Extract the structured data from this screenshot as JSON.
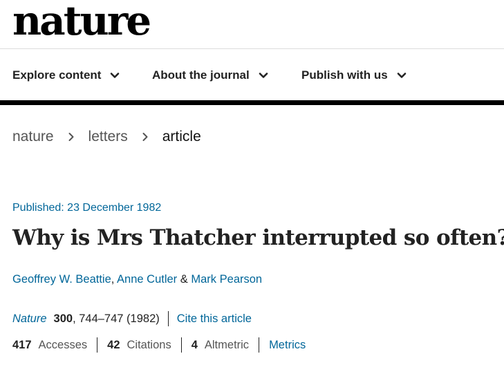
{
  "header": {
    "logo_text": "nature"
  },
  "nav": {
    "items": [
      {
        "label": "Explore content"
      },
      {
        "label": "About the journal"
      },
      {
        "label": "Publish with us"
      }
    ]
  },
  "breadcrumb": {
    "items": [
      {
        "label": "nature"
      },
      {
        "label": "letters"
      },
      {
        "label": "article"
      }
    ]
  },
  "article": {
    "published": "Published: 23 December 1982",
    "title": "Why is Mrs Thatcher interrupted so often?",
    "authors": [
      "Geoffrey W. Beattie",
      "Anne Cutler",
      "Mark Pearson"
    ],
    "author_sep": ",",
    "author_amp": "&",
    "citation": {
      "journal": "Nature",
      "volume": "300",
      "details": ", 744–747 (1982)",
      "cite_label": "Cite this article"
    },
    "metrics": {
      "accesses_count": "417",
      "accesses_label": "Accesses",
      "citations_count": "42",
      "citations_label": "Citations",
      "altmetric_count": "4",
      "altmetric_label": "Altmetric",
      "metrics_link": "Metrics"
    }
  },
  "colors": {
    "link": "#006699",
    "text": "#222222",
    "rule": "#000000"
  }
}
